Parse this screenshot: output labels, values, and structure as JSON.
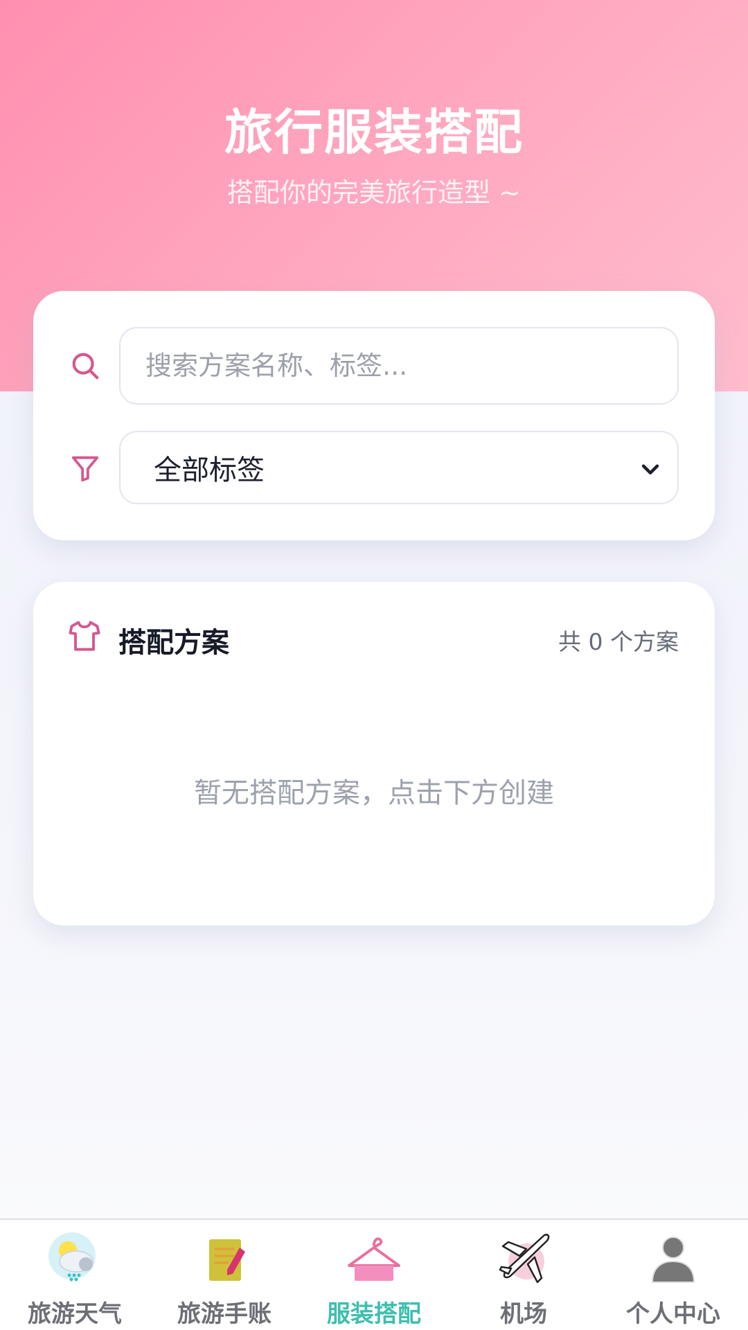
{
  "header": {
    "title": "旅行服装搭配",
    "subtitle": "搭配你的完美旅行造型 ~"
  },
  "filters": {
    "search_placeholder": "搜索方案名称、标签...",
    "search_value": "",
    "tag_select_value": "全部标签"
  },
  "plans": {
    "title": "搭配方案",
    "count_text": "共 0 个方案",
    "empty_text": "暂无搭配方案，点击下方创建"
  },
  "tabbar": {
    "items": [
      {
        "label": "旅游天气",
        "icon": "weather-icon",
        "active": false
      },
      {
        "label": "旅游手账",
        "icon": "notebook-icon",
        "active": false
      },
      {
        "label": "服装搭配",
        "icon": "hanger-icon",
        "active": true
      },
      {
        "label": "机场",
        "icon": "airplane-icon",
        "active": false
      },
      {
        "label": "个人中心",
        "icon": "user-icon",
        "active": false
      }
    ]
  },
  "colors": {
    "hero_gradient_start": "#ff8fb0",
    "hero_gradient_end": "#ffbccd",
    "accent_pink": "#d6578f",
    "active_tab": "#3dbfae",
    "inactive_tab": "#6d6f76"
  }
}
